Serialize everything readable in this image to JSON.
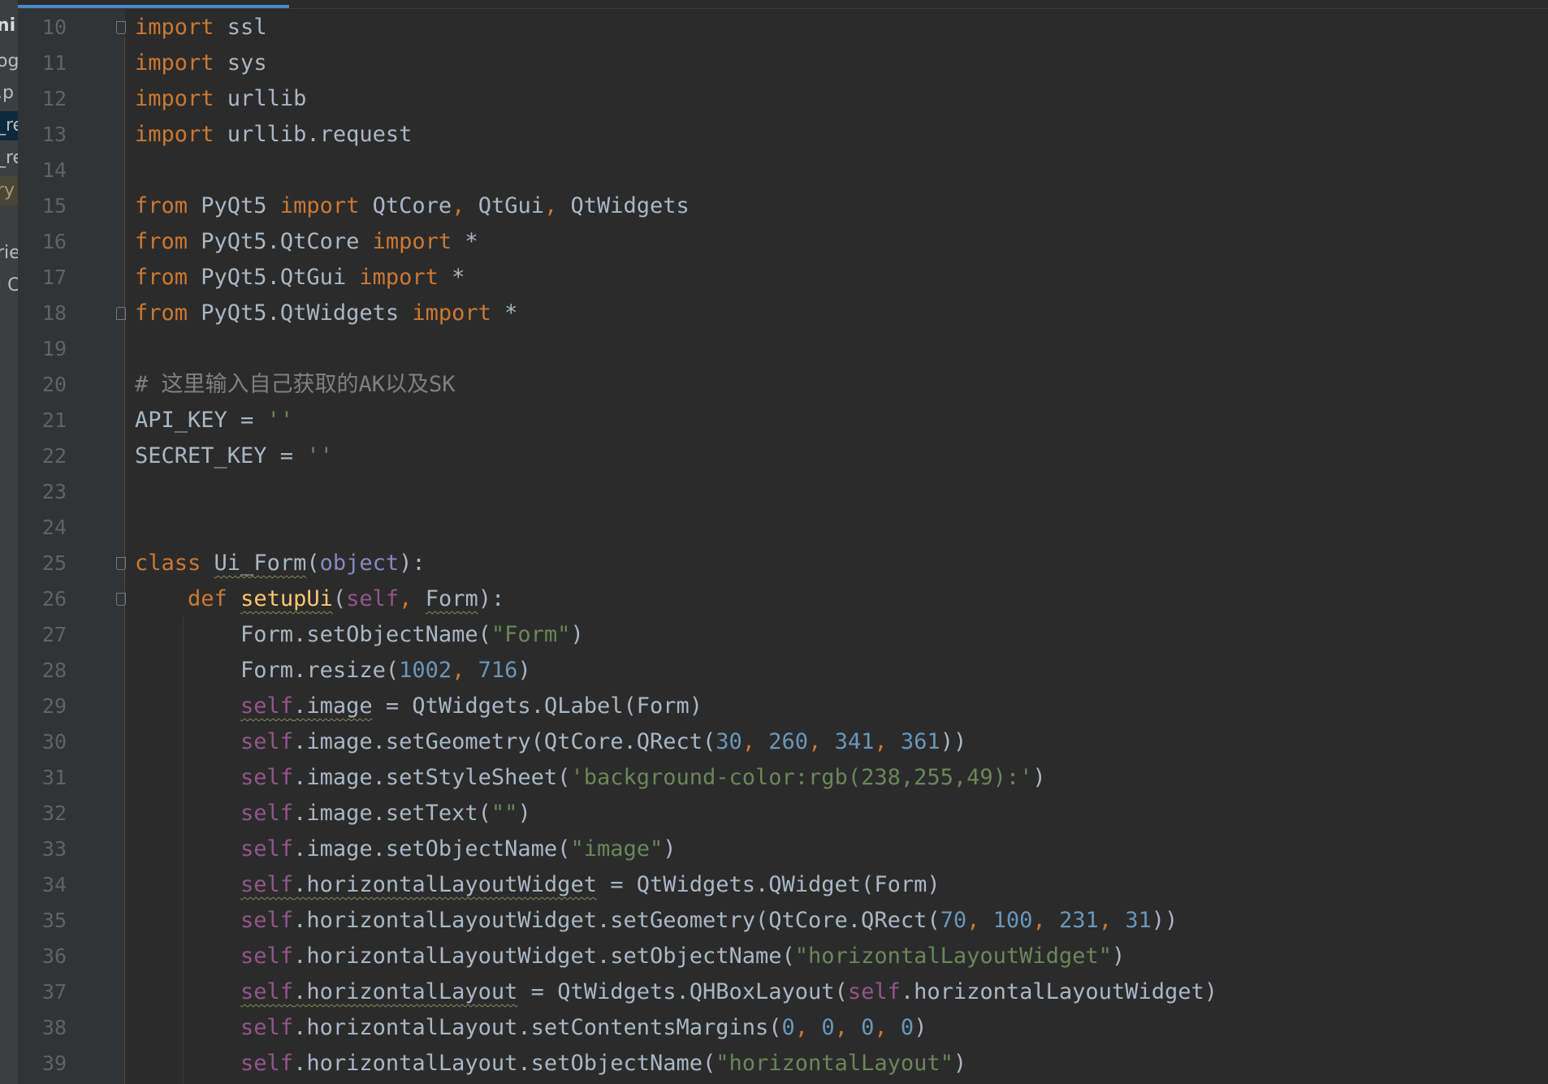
{
  "sidebar": {
    "items": [
      {
        "text": "ni",
        "style": "bold"
      },
      {
        "text": "og",
        "style": "normal"
      },
      {
        "text": ".p",
        "style": "normal"
      },
      {
        "text": "_re",
        "style": "selected"
      },
      {
        "text": "_re",
        "style": "normal"
      },
      {
        "text": "ry",
        "style": "highlight"
      },
      {
        "text": "rie",
        "style": "normal"
      },
      {
        "text": "l C",
        "style": "normal"
      }
    ]
  },
  "editor": {
    "colors": {
      "keyword": "#cc7832",
      "string": "#6a8759",
      "number": "#6897bb",
      "self": "#94558d",
      "function": "#ffc66d",
      "comment": "#808080",
      "builtin": "#8888c6",
      "default": "#a9b7c6",
      "background": "#2b2b2b",
      "gutter": "#313335"
    },
    "lines": [
      {
        "num": "10",
        "fold": "start",
        "tokens": [
          [
            "kw",
            "import"
          ],
          [
            "t",
            " ssl"
          ]
        ]
      },
      {
        "num": "11",
        "tokens": [
          [
            "kw",
            "import"
          ],
          [
            "t",
            " sys"
          ]
        ]
      },
      {
        "num": "12",
        "tokens": [
          [
            "kw",
            "import"
          ],
          [
            "t",
            " urllib"
          ]
        ]
      },
      {
        "num": "13",
        "tokens": [
          [
            "kw",
            "import"
          ],
          [
            "t",
            " urllib.request"
          ]
        ]
      },
      {
        "num": "14",
        "tokens": []
      },
      {
        "num": "15",
        "tokens": [
          [
            "kw",
            "from"
          ],
          [
            "t",
            " PyQt5 "
          ],
          [
            "kw",
            "import"
          ],
          [
            "t",
            " QtCore"
          ],
          [
            "kw",
            ","
          ],
          [
            "t",
            " QtGui"
          ],
          [
            "kw",
            ","
          ],
          [
            "t",
            " QtWidgets"
          ]
        ]
      },
      {
        "num": "16",
        "tokens": [
          [
            "kw",
            "from"
          ],
          [
            "t",
            " PyQt5.QtCore "
          ],
          [
            "kw",
            "import"
          ],
          [
            "t",
            " *"
          ]
        ]
      },
      {
        "num": "17",
        "tokens": [
          [
            "kw",
            "from"
          ],
          [
            "t",
            " PyQt5.QtGui "
          ],
          [
            "kw",
            "import"
          ],
          [
            "t",
            " *"
          ]
        ]
      },
      {
        "num": "18",
        "fold": "end",
        "tokens": [
          [
            "kw",
            "from"
          ],
          [
            "t",
            " PyQt5.QtWidgets "
          ],
          [
            "kw",
            "import"
          ],
          [
            "t",
            " *"
          ]
        ]
      },
      {
        "num": "19",
        "tokens": []
      },
      {
        "num": "20",
        "tokens": [
          [
            "cmt",
            "# 这里输入自己获取的AK以及SK"
          ]
        ]
      },
      {
        "num": "21",
        "tokens": [
          [
            "t",
            "API_KEY = "
          ],
          [
            "str",
            "''"
          ]
        ]
      },
      {
        "num": "22",
        "tokens": [
          [
            "t",
            "SECRET_KEY = "
          ],
          [
            "str",
            "''"
          ]
        ]
      },
      {
        "num": "23",
        "tokens": []
      },
      {
        "num": "24",
        "tokens": []
      },
      {
        "num": "25",
        "fold": "start",
        "tokens": [
          [
            "kw",
            "class"
          ],
          [
            "t",
            " "
          ],
          [
            "sq",
            "Ui_Form"
          ],
          [
            "t",
            "("
          ],
          [
            "builtin",
            "object"
          ],
          [
            "t",
            "):"
          ]
        ]
      },
      {
        "num": "26",
        "fold": "start",
        "tokens": [
          [
            "t",
            "    "
          ],
          [
            "kw",
            "def"
          ],
          [
            "t",
            " "
          ],
          [
            "fnsq",
            "setupUi"
          ],
          [
            "t",
            "("
          ],
          [
            "self",
            "self"
          ],
          [
            "kw",
            ","
          ],
          [
            "t",
            " "
          ],
          [
            "sq",
            "Form"
          ],
          [
            "t",
            "):"
          ]
        ]
      },
      {
        "num": "27",
        "tokens": [
          [
            "t",
            "        Form.setObjectName("
          ],
          [
            "str",
            "\"Form\""
          ],
          [
            "t",
            ")"
          ]
        ]
      },
      {
        "num": "28",
        "tokens": [
          [
            "t",
            "        Form.resize("
          ],
          [
            "num",
            "1002"
          ],
          [
            "kw",
            ","
          ],
          [
            "t",
            " "
          ],
          [
            "num",
            "716"
          ],
          [
            "t",
            ")"
          ]
        ]
      },
      {
        "num": "29",
        "tokens": [
          [
            "t",
            "        "
          ],
          [
            "selfsq",
            "self"
          ],
          [
            "sq",
            ".image"
          ],
          [
            "t",
            " = QtWidgets.QLabel(Form)"
          ]
        ]
      },
      {
        "num": "30",
        "tokens": [
          [
            "t",
            "        "
          ],
          [
            "self",
            "self"
          ],
          [
            "t",
            ".image.setGeometry(QtCore.QRect("
          ],
          [
            "num",
            "30"
          ],
          [
            "kw",
            ","
          ],
          [
            "t",
            " "
          ],
          [
            "num",
            "260"
          ],
          [
            "kw",
            ","
          ],
          [
            "t",
            " "
          ],
          [
            "num",
            "341"
          ],
          [
            "kw",
            ","
          ],
          [
            "t",
            " "
          ],
          [
            "num",
            "361"
          ],
          [
            "t",
            "))"
          ]
        ]
      },
      {
        "num": "31",
        "tokens": [
          [
            "t",
            "        "
          ],
          [
            "self",
            "self"
          ],
          [
            "t",
            ".image.setStyleSheet("
          ],
          [
            "str",
            "'background-color:rgb(238,255,49):'"
          ],
          [
            "t",
            ")"
          ]
        ]
      },
      {
        "num": "32",
        "tokens": [
          [
            "t",
            "        "
          ],
          [
            "self",
            "self"
          ],
          [
            "t",
            ".image.setText("
          ],
          [
            "str",
            "\"\""
          ],
          [
            "t",
            ")"
          ]
        ]
      },
      {
        "num": "33",
        "tokens": [
          [
            "t",
            "        "
          ],
          [
            "self",
            "self"
          ],
          [
            "t",
            ".image.setObjectName("
          ],
          [
            "str",
            "\"image\""
          ],
          [
            "t",
            ")"
          ]
        ]
      },
      {
        "num": "34",
        "tokens": [
          [
            "t",
            "        "
          ],
          [
            "selfsq",
            "self"
          ],
          [
            "sq",
            ".horizontalLayoutWidget"
          ],
          [
            "t",
            " = QtWidgets.QWidget(Form)"
          ]
        ]
      },
      {
        "num": "35",
        "tokens": [
          [
            "t",
            "        "
          ],
          [
            "self",
            "self"
          ],
          [
            "t",
            ".horizontalLayoutWidget.setGeometry(QtCore.QRect("
          ],
          [
            "num",
            "70"
          ],
          [
            "kw",
            ","
          ],
          [
            "t",
            " "
          ],
          [
            "num",
            "100"
          ],
          [
            "kw",
            ","
          ],
          [
            "t",
            " "
          ],
          [
            "num",
            "231"
          ],
          [
            "kw",
            ","
          ],
          [
            "t",
            " "
          ],
          [
            "num",
            "31"
          ],
          [
            "t",
            "))"
          ]
        ]
      },
      {
        "num": "36",
        "tokens": [
          [
            "t",
            "        "
          ],
          [
            "self",
            "self"
          ],
          [
            "t",
            ".horizontalLayoutWidget.setObjectName("
          ],
          [
            "str",
            "\"horizontalLayoutWidget\""
          ],
          [
            "t",
            ")"
          ]
        ]
      },
      {
        "num": "37",
        "tokens": [
          [
            "t",
            "        "
          ],
          [
            "selfsq",
            "self"
          ],
          [
            "sq",
            ".horizontalLayout"
          ],
          [
            "t",
            " = QtWidgets.QHBoxLayout("
          ],
          [
            "self",
            "self"
          ],
          [
            "t",
            ".horizontalLayoutWidget)"
          ]
        ]
      },
      {
        "num": "38",
        "tokens": [
          [
            "t",
            "        "
          ],
          [
            "self",
            "self"
          ],
          [
            "t",
            ".horizontalLayout.setContentsMargins("
          ],
          [
            "num",
            "0"
          ],
          [
            "kw",
            ","
          ],
          [
            "t",
            " "
          ],
          [
            "num",
            "0"
          ],
          [
            "kw",
            ","
          ],
          [
            "t",
            " "
          ],
          [
            "num",
            "0"
          ],
          [
            "kw",
            ","
          ],
          [
            "t",
            " "
          ],
          [
            "num",
            "0"
          ],
          [
            "t",
            ")"
          ]
        ]
      },
      {
        "num": "39",
        "tokens": [
          [
            "t",
            "        "
          ],
          [
            "self",
            "self"
          ],
          [
            "t",
            ".horizontalLayout.setObjectName("
          ],
          [
            "str",
            "\"horizontalLayout\""
          ],
          [
            "t",
            ")"
          ]
        ]
      }
    ]
  }
}
